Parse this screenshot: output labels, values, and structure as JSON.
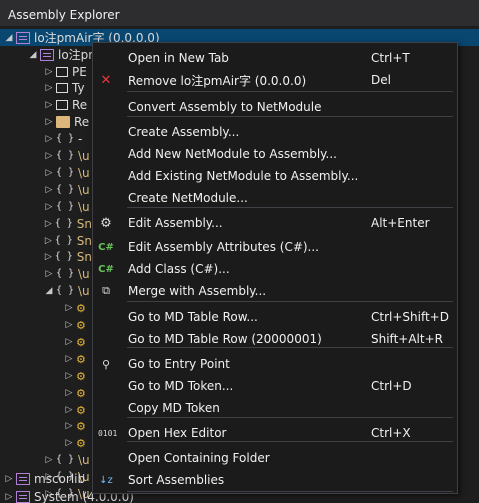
{
  "panel": {
    "title": "Assembly Explorer"
  },
  "tree": {
    "root_label": "lo注pmAir字 (0.0.0.0)",
    "module_label": "lo注pm",
    "rows": [
      {
        "exp": "▷",
        "icon": "class",
        "label": "PE"
      },
      {
        "exp": "▷",
        "icon": "class",
        "label": "Ty"
      },
      {
        "exp": "▷",
        "icon": "class",
        "label": "Re"
      },
      {
        "exp": "▷",
        "icon": "folder",
        "label": "Re"
      },
      {
        "exp": "▷",
        "icon": "ns",
        "label": "-"
      },
      {
        "exp": "▷",
        "icon": "ns",
        "label": "\\u"
      },
      {
        "exp": "▷",
        "icon": "ns",
        "label": "\\u"
      },
      {
        "exp": "▷",
        "icon": "ns",
        "label": "\\u"
      },
      {
        "exp": "▷",
        "icon": "ns",
        "label": "\\u"
      },
      {
        "exp": "▷",
        "icon": "ns",
        "label": "Sn"
      },
      {
        "exp": "▷",
        "icon": "ns",
        "label": "Sn"
      },
      {
        "exp": "▷",
        "icon": "ns",
        "label": "Sn"
      },
      {
        "exp": "▷",
        "icon": "ns",
        "label": "\\u"
      },
      {
        "exp": "◢",
        "icon": "ns",
        "label": "\\u"
      },
      {
        "exp": "▷",
        "icon": "gear",
        "label": ""
      },
      {
        "exp": "▷",
        "icon": "gear",
        "label": ""
      },
      {
        "exp": "▷",
        "icon": "gear",
        "label": ""
      },
      {
        "exp": "▷",
        "icon": "gear",
        "label": ""
      },
      {
        "exp": "▷",
        "icon": "gear",
        "label": ""
      },
      {
        "exp": "▷",
        "icon": "gear",
        "label": ""
      },
      {
        "exp": "▷",
        "icon": "gear",
        "label": ""
      },
      {
        "exp": "▷",
        "icon": "gear",
        "label": ""
      },
      {
        "exp": "▷",
        "icon": "gear",
        "label": ""
      },
      {
        "exp": "▷",
        "icon": "ns",
        "label": "\\u"
      },
      {
        "exp": "▷",
        "icon": "ns",
        "label": "\\u"
      },
      {
        "exp": "▷",
        "icon": "ns",
        "label": "\\u"
      },
      {
        "exp": "▷",
        "icon": "ns",
        "label": "\\u"
      }
    ],
    "mscorlib_label": "mscorlib",
    "system_label": "System (4.0.0.0)"
  },
  "menu": {
    "items": [
      {
        "icon": "",
        "icon_name": "none",
        "label": "Open in New Tab",
        "key": "Ctrl+T"
      },
      {
        "icon": "✕",
        "icon_name": "remove-icon",
        "label": "Remove lo注pmAir字 (0.0.0.0)",
        "key": "Del"
      },
      {
        "icon": "",
        "icon_name": "none",
        "label": "Convert Assembly to NetModule",
        "key": ""
      },
      {
        "icon": "",
        "icon_name": "none",
        "label": "Create Assembly...",
        "key": ""
      },
      {
        "icon": "",
        "icon_name": "none",
        "label": "Add New NetModule to Assembly...",
        "key": ""
      },
      {
        "icon": "",
        "icon_name": "none",
        "label": "Add Existing NetModule to Assembly...",
        "key": ""
      },
      {
        "icon": "",
        "icon_name": "none",
        "label": "Create NetModule...",
        "key": ""
      },
      {
        "icon": "⚙",
        "icon_name": "gear-icon",
        "label": "Edit Assembly...",
        "key": "Alt+Enter"
      },
      {
        "icon": "C#",
        "icon_name": "csharp-icon",
        "label": "Edit Assembly Attributes (C#)...",
        "key": ""
      },
      {
        "icon": "C#",
        "icon_name": "csharp-icon",
        "label": "Add Class (C#)...",
        "key": ""
      },
      {
        "icon": "⧉",
        "icon_name": "merge-icon",
        "label": "Merge with Assembly...",
        "key": ""
      },
      {
        "icon": "",
        "icon_name": "none",
        "label": "Go to MD Table Row...",
        "key": "Ctrl+Shift+D"
      },
      {
        "icon": "",
        "icon_name": "none",
        "label": "Go to MD Table Row (20000001)",
        "key": "Shift+Alt+R"
      },
      {
        "icon": "⚲",
        "icon_name": "entry-point-icon",
        "label": "Go to Entry Point",
        "key": ""
      },
      {
        "icon": "",
        "icon_name": "none",
        "label": "Go to MD Token...",
        "key": "Ctrl+D"
      },
      {
        "icon": "",
        "icon_name": "none",
        "label": "Copy MD Token",
        "key": ""
      },
      {
        "icon": "0101",
        "icon_name": "hex-editor-icon",
        "label": "Open Hex Editor",
        "key": "Ctrl+X"
      },
      {
        "icon": "",
        "icon_name": "none",
        "label": "Open Containing Folder",
        "key": ""
      },
      {
        "icon": "↓z",
        "icon_name": "sort-icon",
        "label": "Sort Assemblies",
        "key": ""
      }
    ]
  },
  "colors": {
    "background": "#1e1e1e",
    "menu_bg": "#1b1b1c",
    "selection": "#094771",
    "remove_icon": "#e5383b",
    "csharp_icon": "#68c25a",
    "namespace_text": "#d7ba7d"
  }
}
